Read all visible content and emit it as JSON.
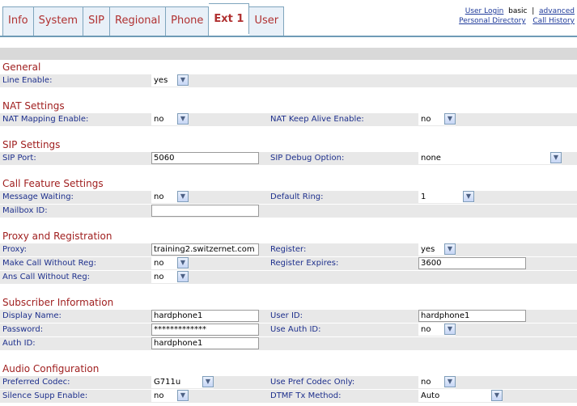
{
  "tabs": [
    {
      "label": "Info"
    },
    {
      "label": "System"
    },
    {
      "label": "SIP"
    },
    {
      "label": "Regional"
    },
    {
      "label": "Phone"
    },
    {
      "label": "Ext 1",
      "active": true
    },
    {
      "label": "User"
    }
  ],
  "top_links": {
    "user_login": "User Login",
    "basic": "basic",
    "separator": "|",
    "advanced": "advanced",
    "personal_directory": "Personal Directory",
    "call_history": "Call History"
  },
  "sections": {
    "general": "General",
    "nat": "NAT Settings",
    "sip": "SIP Settings",
    "call_feature": "Call Feature Settings",
    "proxy": "Proxy and Registration",
    "subscriber": "Subscriber Information",
    "audio": "Audio Configuration"
  },
  "fields": {
    "line_enable": {
      "label": "Line Enable:",
      "value": "yes"
    },
    "nat_mapping_enable": {
      "label": "NAT Mapping Enable:",
      "value": "no"
    },
    "nat_keep_alive_enable": {
      "label": "NAT Keep Alive Enable:",
      "value": "no"
    },
    "sip_port": {
      "label": "SIP Port:",
      "value": "5060"
    },
    "sip_debug_option": {
      "label": "SIP Debug Option:",
      "value": "none"
    },
    "message_waiting": {
      "label": "Message Waiting:",
      "value": "no"
    },
    "default_ring": {
      "label": "Default Ring:",
      "value": "1"
    },
    "mailbox_id": {
      "label": "Mailbox ID:",
      "value": ""
    },
    "proxy": {
      "label": "Proxy:",
      "value": "training2.switzernet.com"
    },
    "register": {
      "label": "Register:",
      "value": "yes"
    },
    "make_call_without_reg": {
      "label": "Make Call Without Reg:",
      "value": "no"
    },
    "register_expires": {
      "label": "Register Expires:",
      "value": "3600"
    },
    "ans_call_without_reg": {
      "label": "Ans Call Without Reg:",
      "value": "no"
    },
    "display_name": {
      "label": "Display Name:",
      "value": "hardphone1"
    },
    "user_id": {
      "label": "User ID:",
      "value": "hardphone1"
    },
    "password": {
      "label": "Password:",
      "value": "*************"
    },
    "use_auth_id": {
      "label": "Use Auth ID:",
      "value": "no"
    },
    "auth_id": {
      "label": "Auth ID:",
      "value": "hardphone1"
    },
    "preferred_codec": {
      "label": "Preferred Codec:",
      "value": "G711u"
    },
    "use_pref_codec_only": {
      "label": "Use Pref Codec Only:",
      "value": "no"
    },
    "silence_supp_enable": {
      "label": "Silence Supp Enable:",
      "value": "no"
    },
    "dtmf_tx_method": {
      "label": "DTMF Tx Method:",
      "value": "Auto"
    }
  },
  "icons": {
    "dropdown": "chevron-down-icon"
  }
}
